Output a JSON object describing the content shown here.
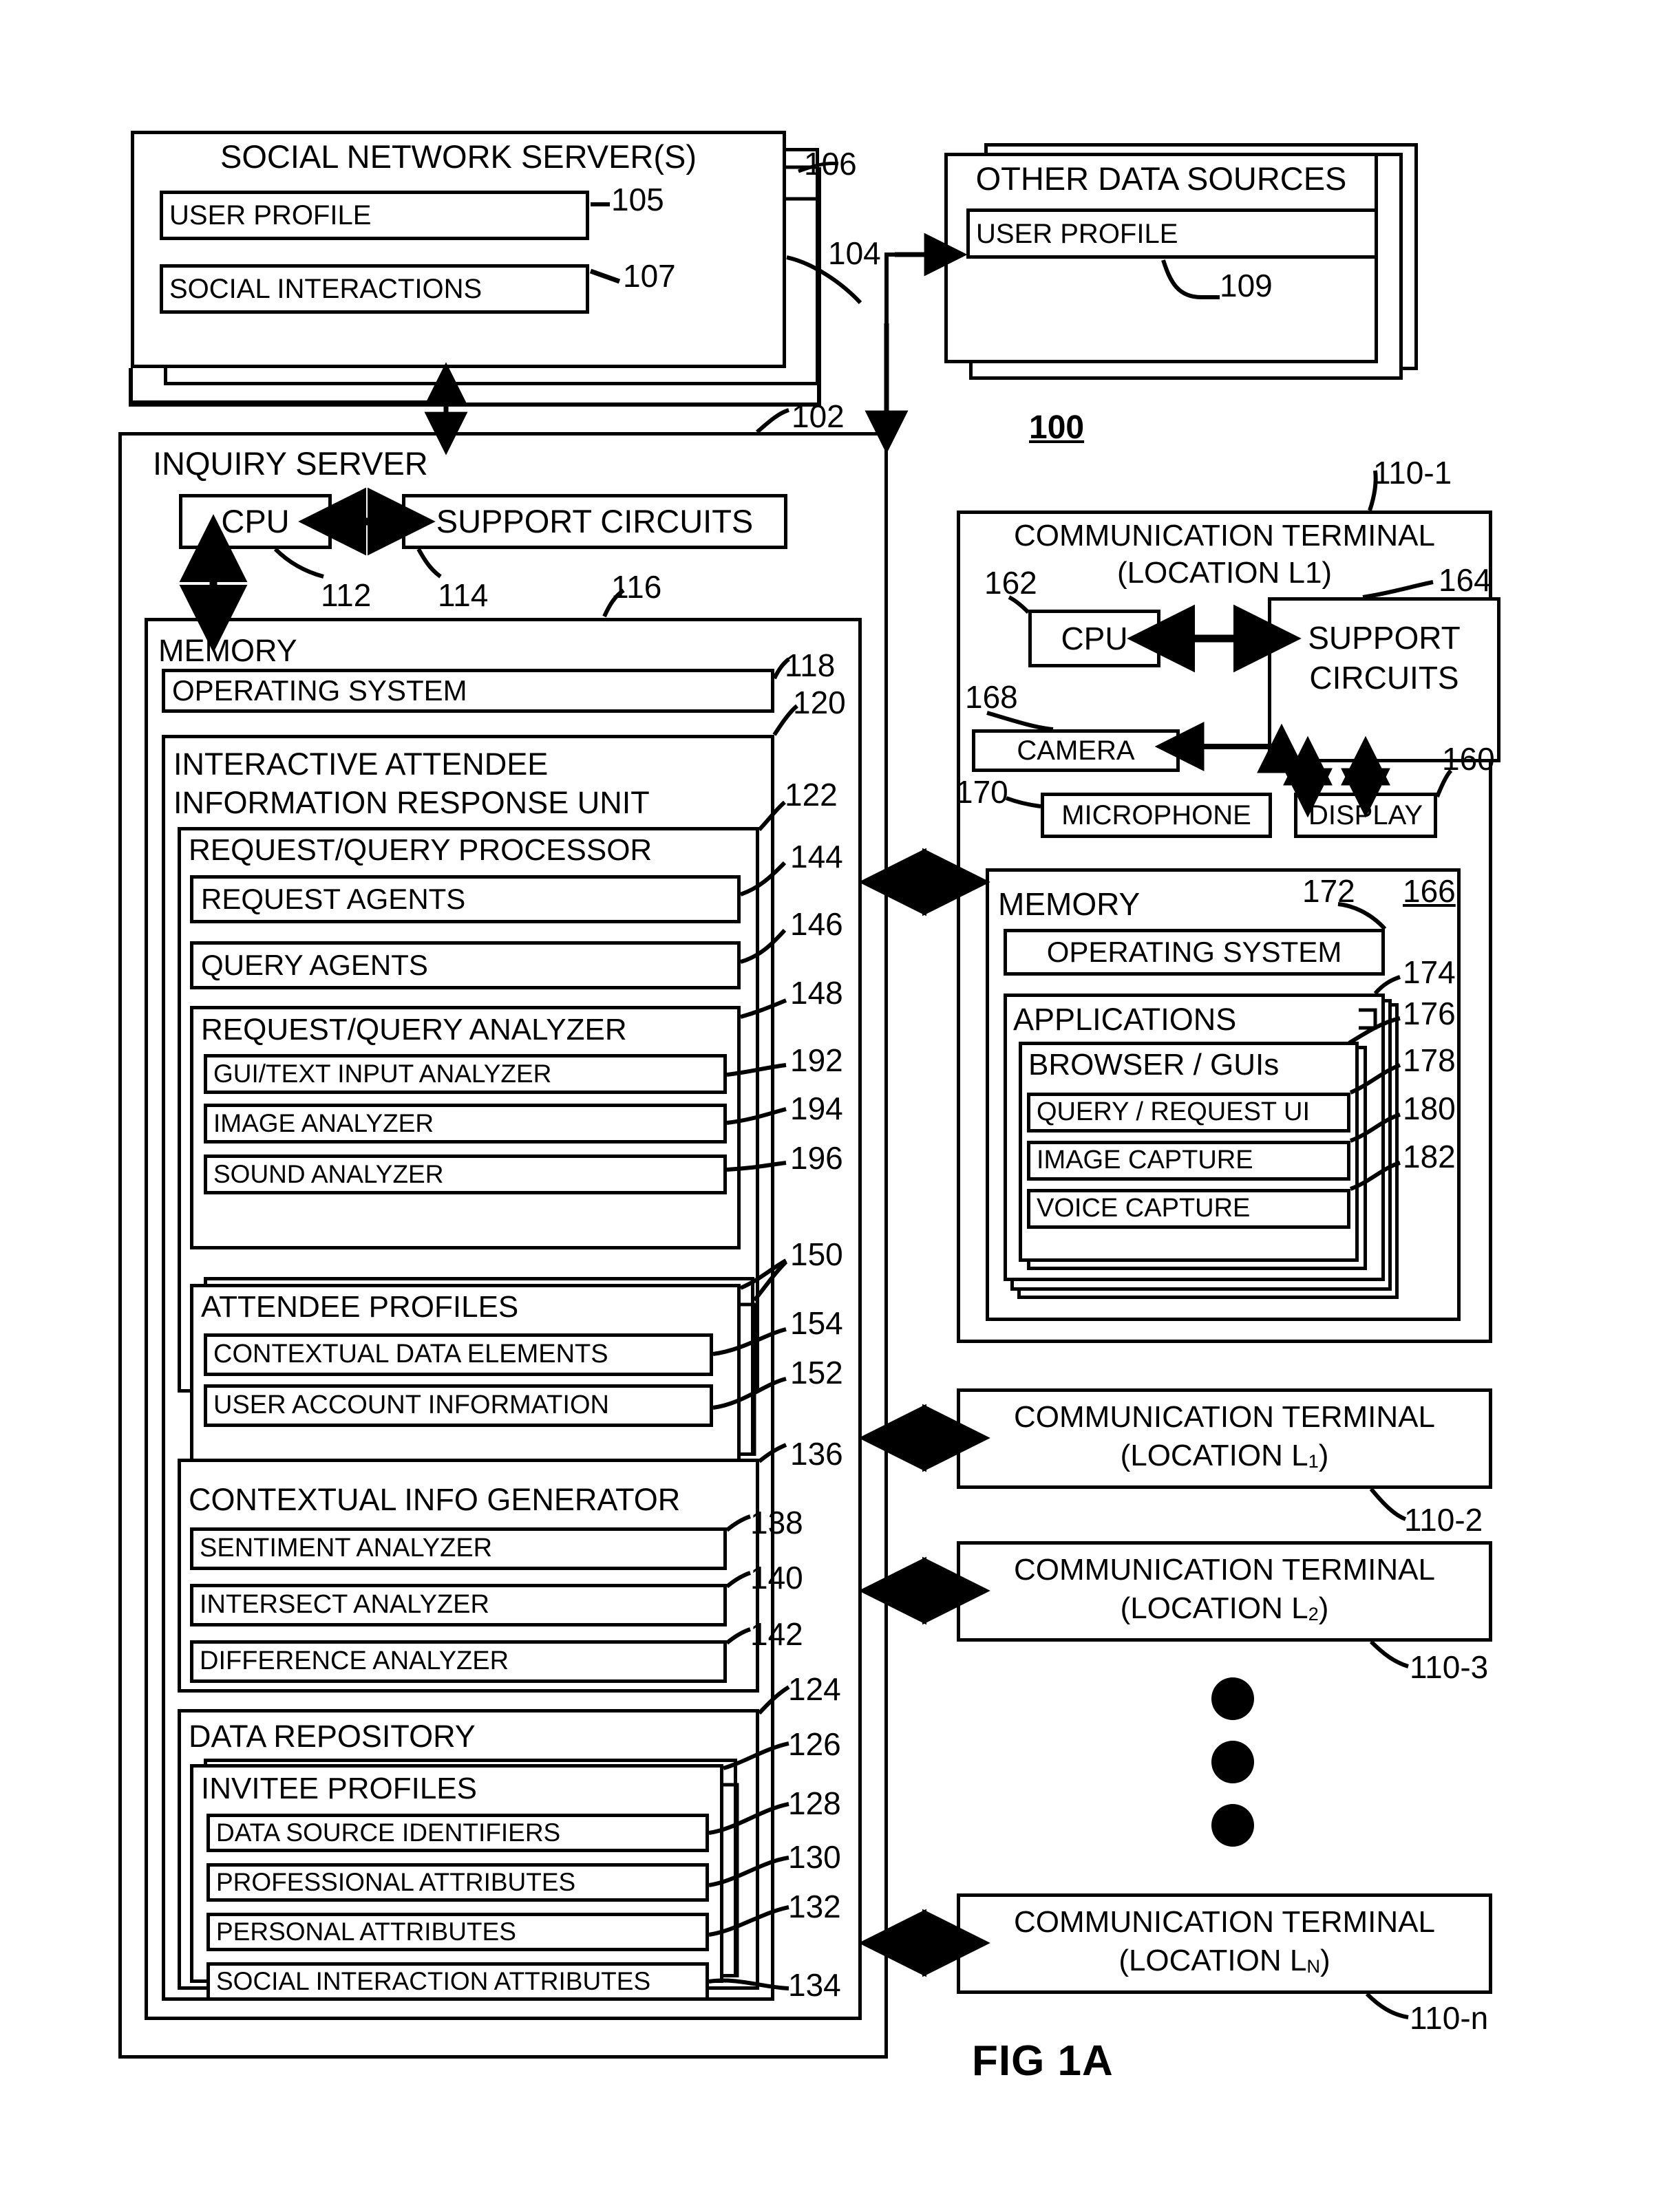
{
  "figure": {
    "label": "FIG 1A",
    "system_ref": "100"
  },
  "social_network_server": {
    "title": "SOCIAL NETWORK SERVER(S)",
    "ref": "106",
    "link_ref": "104",
    "items": [
      {
        "label": "USER PROFILE",
        "ref": "105"
      },
      {
        "label": "SOCIAL INTERACTIONS",
        "ref": "107"
      }
    ]
  },
  "other_data_sources": {
    "title": "OTHER DATA SOURCES",
    "items": [
      {
        "label": "USER PROFILE",
        "ref": "109"
      }
    ]
  },
  "inquiry_server": {
    "title": "INQUIRY SERVER",
    "ref": "102",
    "cpu": {
      "label": "CPU",
      "ref": "112"
    },
    "support_circuits": {
      "label": "SUPPORT CIRCUITS",
      "ref": "114"
    },
    "memory": {
      "label": "MEMORY",
      "ref": "116",
      "operating_system": {
        "label": "OPERATING SYSTEM",
        "ref": "118"
      },
      "response_unit": {
        "label_line1": "INTERACTIVE ATTENDEE",
        "label_line2": "INFORMATION RESPONSE UNIT",
        "ref": "120",
        "request_query_processor": {
          "label": "REQUEST/QUERY PROCESSOR",
          "ref": "122",
          "request_agents": {
            "label": "REQUEST AGENTS",
            "ref": "144"
          },
          "query_agents": {
            "label": "QUERY AGENTS",
            "ref": "146"
          },
          "request_query_analyzer": {
            "label": "REQUEST/QUERY ANALYZER",
            "ref": "148",
            "items": [
              {
                "label": "GUI/TEXT INPUT ANALYZER",
                "ref": "192"
              },
              {
                "label": "IMAGE ANALYZER",
                "ref": "194"
              },
              {
                "label": "SOUND ANALYZER",
                "ref": "196"
              }
            ]
          },
          "attendee_profiles": {
            "label": "ATTENDEE PROFILES",
            "ref": "150",
            "items": [
              {
                "label": "CONTEXTUAL DATA ELEMENTS",
                "ref": "154"
              },
              {
                "label": "USER ACCOUNT INFORMATION",
                "ref": "152"
              }
            ]
          }
        },
        "contextual_info_generator": {
          "label": "CONTEXTUAL INFO GENERATOR",
          "ref": "136",
          "items": [
            {
              "label": "SENTIMENT ANALYZER",
              "ref": "138"
            },
            {
              "label": "INTERSECT ANALYZER",
              "ref": "140"
            },
            {
              "label": "DIFFERENCE ANALYZER",
              "ref": "142"
            }
          ]
        },
        "data_repository": {
          "label": "DATA REPOSITORY",
          "ref": "124",
          "invitee_profiles": {
            "label": "INVITEE PROFILES",
            "ref": "126",
            "items": [
              {
                "label": "DATA SOURCE IDENTIFIERS",
                "ref": "128"
              },
              {
                "label": "PROFESSIONAL ATTRIBUTES",
                "ref": "130"
              },
              {
                "label": "PERSONAL ATTRIBUTES",
                "ref": "132"
              },
              {
                "label": "SOCIAL INTERACTION ATTRIBUTES",
                "ref": "134"
              }
            ]
          }
        }
      }
    }
  },
  "communication_terminal_1": {
    "title_line1": "COMMUNICATION TERMINAL",
    "title_line2": "(LOCATION L1)",
    "ref": "110-1",
    "cpu": {
      "label": "CPU",
      "ref": "162"
    },
    "support_circuits": {
      "label_line1": "SUPPORT",
      "label_line2": "CIRCUITS",
      "ref": "164"
    },
    "camera": {
      "label": "CAMERA",
      "ref": "168"
    },
    "microphone": {
      "label": "MICROPHONE",
      "ref": "170"
    },
    "display": {
      "label": "DISPLAY",
      "ref": "160"
    },
    "memory": {
      "label": "MEMORY",
      "ref": "166",
      "operating_system": {
        "label": "OPERATING SYSTEM",
        "ref": "172"
      },
      "applications": {
        "label": "APPLICATIONS",
        "ref": "174",
        "browser_guis": {
          "label": "BROWSER / GUIs",
          "ref": "176",
          "items": [
            {
              "label": "QUERY / REQUEST UI",
              "ref": "178"
            },
            {
              "label": "IMAGE CAPTURE",
              "ref": "180"
            },
            {
              "label": "VOICE CAPTURE",
              "ref": "182"
            }
          ]
        }
      }
    }
  },
  "other_terminals": [
    {
      "title_line1": "COMMUNICATION TERMINAL",
      "title_line2_pre": "(LOCATION L",
      "title_line2_sub": "1",
      "title_line2_post": ")",
      "ref": "110-2"
    },
    {
      "title_line1": "COMMUNICATION TERMINAL",
      "title_line2_pre": "(LOCATION L",
      "title_line2_sub": "2",
      "title_line2_post": ")",
      "ref": "110-3"
    },
    {
      "title_line1": "COMMUNICATION TERMINAL",
      "title_line2_pre": "(LOCATION L",
      "title_line2_sub": "N",
      "title_line2_post": ")",
      "ref": "110-n"
    }
  ]
}
